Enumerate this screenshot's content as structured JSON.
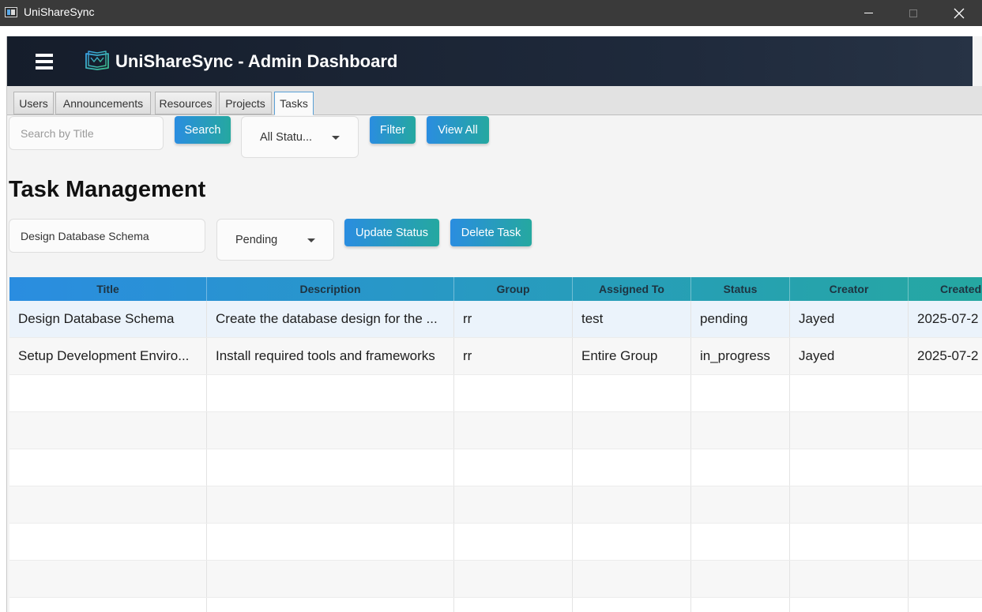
{
  "window": {
    "title": "UniShareSync",
    "icon": "app-window-icon",
    "controls": [
      "minimize-icon",
      "maximize-icon",
      "close-icon"
    ]
  },
  "header": {
    "menu_icon": "hamburger-menu-icon",
    "logo_icon": "book-icon",
    "title": "UniShareSync - Admin Dashboard"
  },
  "tabs": [
    {
      "label": "Users",
      "active": false
    },
    {
      "label": "Announcements",
      "active": false
    },
    {
      "label": "Resources",
      "active": false
    },
    {
      "label": "Projects",
      "active": false
    },
    {
      "label": "Tasks",
      "active": true
    }
  ],
  "search_bar": {
    "placeholder": "Search by Title",
    "value": "",
    "search_label": "Search",
    "status_filter": "All Statu...",
    "filter_label": "Filter",
    "view_all_label": "View All"
  },
  "page_title": "Task Management",
  "edit_bar": {
    "task_value": "Design Database Schema",
    "status_value": "Pending",
    "update_label": "Update Status",
    "delete_label": "Delete Task"
  },
  "table": {
    "columns": [
      "Title",
      "Description",
      "Group",
      "Assigned To",
      "Status",
      "Creator",
      "Created"
    ],
    "rows": [
      [
        "Design Database Schema",
        "Create the database design for the ...",
        "rr",
        "test",
        "pending",
        "Jayed",
        "2025-07-2"
      ],
      [
        "Setup Development Enviro...",
        "Install required tools and frameworks",
        "rr",
        "Entire Group",
        "in_progress",
        "Jayed",
        "2025-07-2"
      ]
    ],
    "selected_row": 0,
    "empty_rows": 7
  },
  "colors": {
    "header_bg": "#1a2332",
    "accent_start": "#2a8de0",
    "accent_end": "#25a8a0",
    "selected_row": "#ebf3fb"
  }
}
